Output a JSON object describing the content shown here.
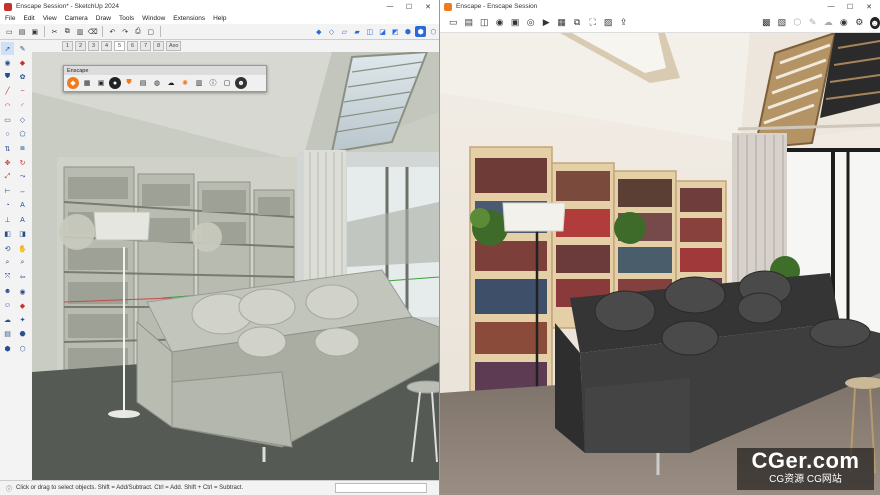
{
  "sketchup": {
    "title": "Enscape Session* - SketchUp 2024",
    "menu": [
      "File",
      "Edit",
      "View",
      "Camera",
      "Draw",
      "Tools",
      "Window",
      "Extensions",
      "Help"
    ],
    "scene_tabs": [
      "1",
      "2",
      "3",
      "4",
      "5",
      "6",
      "7",
      "8",
      "Axo"
    ],
    "active_tab": "5",
    "status": "Click or drag to select objects. Shift = Add/Subtract. Ctrl = Add. Shift + Ctrl = Subtract.",
    "enscape_toolbar_title": "Enscape"
  },
  "enscape": {
    "title": "Enscape - Enscape Session"
  },
  "watermark": {
    "brand": "CGer.com",
    "subtitle": "CG资源 CG网站"
  },
  "colors": {
    "enscape_orange": "#f07b1e",
    "sketchup_red": "#c8302b",
    "selection_blue": "#2a6ad8"
  }
}
